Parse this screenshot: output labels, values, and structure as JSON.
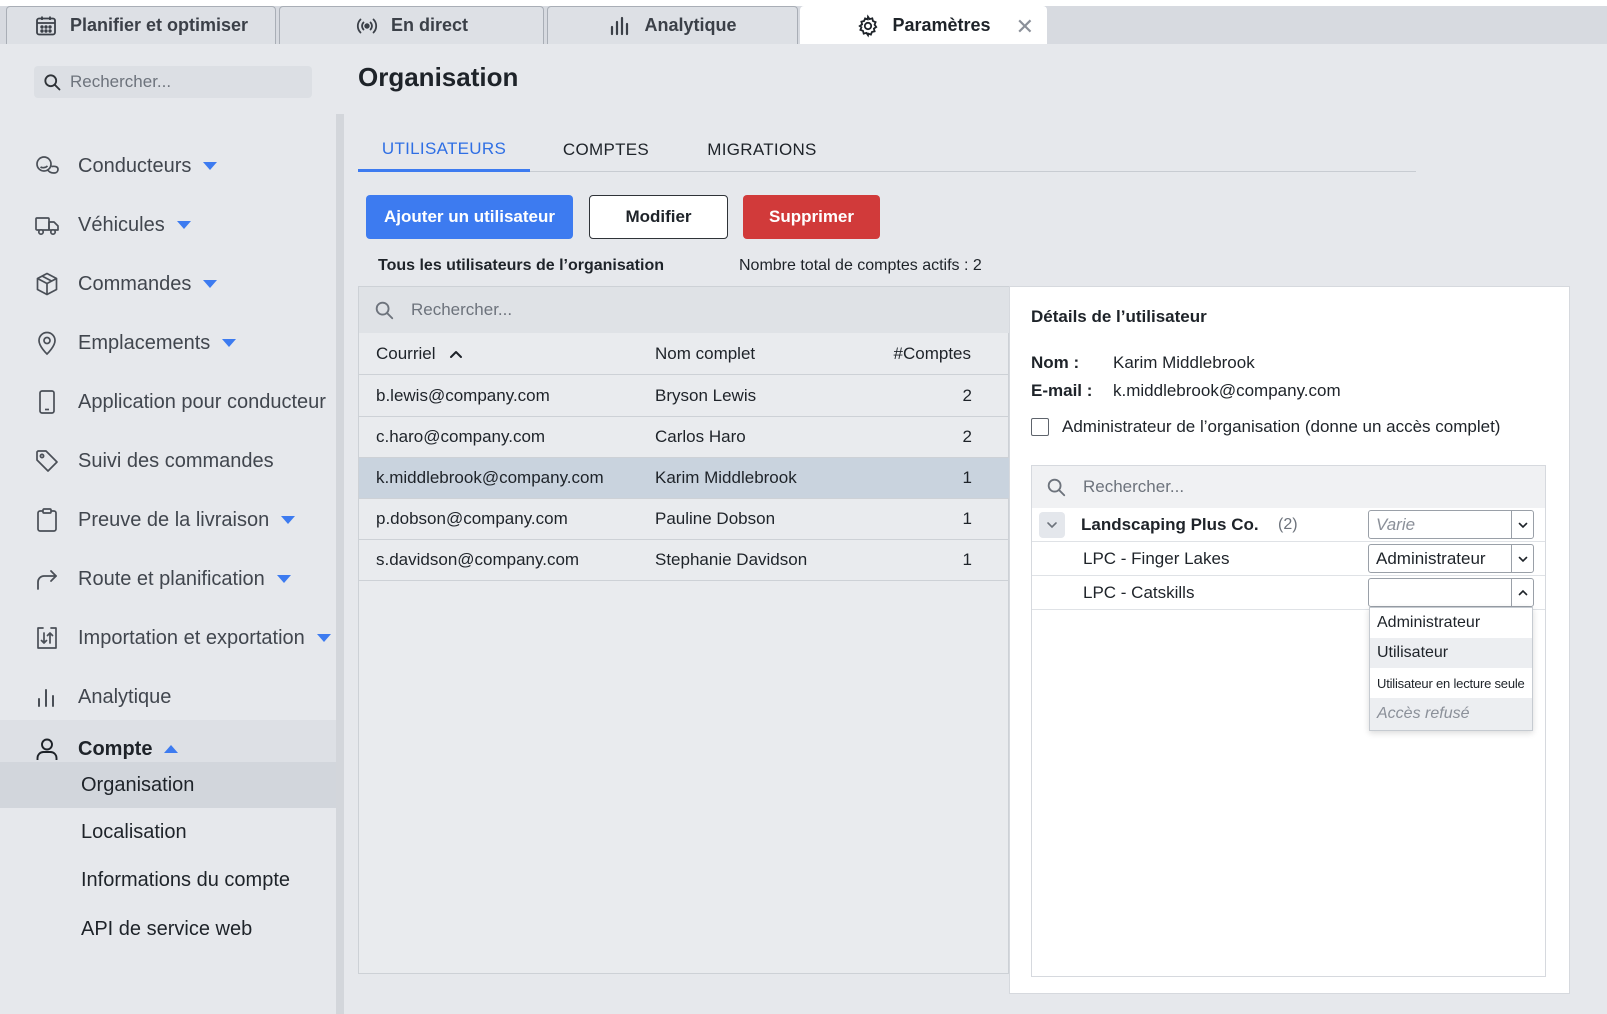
{
  "window_tabs": [
    {
      "label": "Planifier et optimiser",
      "icon": "calendar-icon"
    },
    {
      "label": "En direct",
      "icon": "broadcast-icon"
    },
    {
      "label": "Analytique",
      "icon": "bar-chart-icon"
    },
    {
      "label": "Paramètres",
      "icon": "gear-icon",
      "active": true
    }
  ],
  "sidebar": {
    "search_placeholder": "Rechercher...",
    "items": [
      {
        "label": "Conducteurs",
        "icon": "drivers-icon",
        "caret": "down"
      },
      {
        "label": "Véhicules",
        "icon": "truck-icon",
        "caret": "down"
      },
      {
        "label": "Commandes",
        "icon": "package-icon",
        "caret": "down"
      },
      {
        "label": "Emplacements",
        "icon": "location-pin-icon",
        "caret": "down"
      },
      {
        "label": "Application pour conducteur",
        "icon": "phone-icon"
      },
      {
        "label": "Suivi des commandes",
        "icon": "tag-icon"
      },
      {
        "label": "Preuve de la livraison",
        "icon": "clipboard-icon",
        "caret": "down"
      },
      {
        "label": "Route et planification",
        "icon": "route-arrow-icon",
        "caret": "down"
      },
      {
        "label": "Importation et exportation",
        "icon": "import-export-icon",
        "caret": "down"
      },
      {
        "label": "Analytique",
        "icon": "bar-chart-icon"
      },
      {
        "label": "Compte",
        "icon": "user-icon",
        "caret": "up"
      }
    ],
    "account_sub_items": [
      {
        "label": "Organisation",
        "selected": true
      },
      {
        "label": "Localisation"
      },
      {
        "label": "Informations du compte"
      },
      {
        "label": "API de service web"
      }
    ]
  },
  "main": {
    "title": "Organisation",
    "tabs": [
      {
        "label": "UTILISATEURS",
        "active": true
      },
      {
        "label": "COMPTES"
      },
      {
        "label": "MIGRATIONS"
      }
    ],
    "buttons": {
      "add": "Ajouter un utilisateur",
      "edit": "Modifier",
      "delete": "Supprimer"
    },
    "list_caption": "Tous les utilisateurs de l’organisation",
    "count_caption": "Nombre total de comptes actifs : 2",
    "users_search_placeholder": "Rechercher...",
    "columns": [
      "Courriel",
      "Nom complet",
      "#Comptes"
    ],
    "rows": [
      {
        "email": "b.lewis@company.com",
        "name": "Bryson Lewis",
        "count": "2"
      },
      {
        "email": "c.haro@company.com",
        "name": "Carlos Haro",
        "count": "2"
      },
      {
        "email": "k.middlebrook@company.com",
        "name": "Karim Middlebrook",
        "count": "1",
        "selected": true
      },
      {
        "email": "p.dobson@company.com",
        "name": "Pauline Dobson",
        "count": "1"
      },
      {
        "email": "s.davidson@company.com",
        "name": "Stephanie Davidson",
        "count": "1"
      }
    ]
  },
  "details": {
    "title": "Détails de l’utilisateur",
    "name_label": "Nom :",
    "name_value": "Karim Middlebrook",
    "email_label": "E-mail :",
    "email_value": "k.middlebrook@company.com",
    "admin_label": "Administrateur de l’organisation (donne un accès complet)",
    "admin_checked": false,
    "accounts_search_placeholder": "Rechercher...",
    "accounts": [
      {
        "name": "Landscaping Plus Co.",
        "count": "(2)",
        "role": "Varie",
        "group": true
      },
      {
        "name": "LPC - Finger Lakes",
        "role": "Administrateur"
      },
      {
        "name": "LPC - Catskills",
        "role": "",
        "open": true
      }
    ],
    "role_options": [
      {
        "label": "Administrateur"
      },
      {
        "label": "Utilisateur",
        "hover": true
      },
      {
        "label": "Utilisateur en lecture seule"
      },
      {
        "label": "Accès refusé"
      }
    ]
  },
  "colors": {
    "accent": "#3d7bf0",
    "danger": "#d13a3a",
    "selected_row": "#c9d3de"
  }
}
